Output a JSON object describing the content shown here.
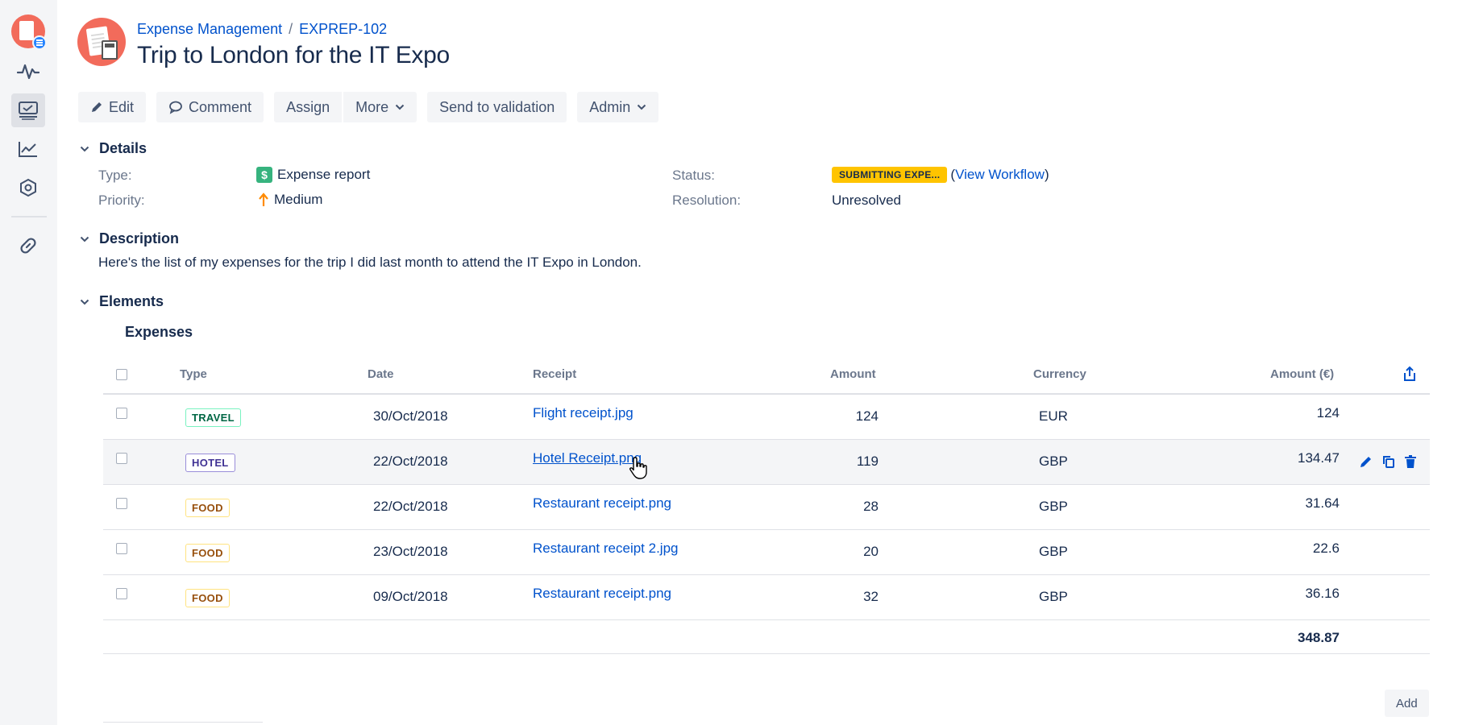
{
  "header": {
    "breadcrumb": {
      "project": "Expense Management",
      "separator": "/",
      "issue_key": "EXPREP-102"
    },
    "title": "Trip to London for the IT Expo"
  },
  "toolbar": {
    "edit_label": "Edit",
    "comment_label": "Comment",
    "assign_label": "Assign",
    "more_label": "More",
    "send_label": "Send to validation",
    "admin_label": "Admin"
  },
  "details": {
    "heading": "Details",
    "type_label": "Type:",
    "type_icon_glyph": "$",
    "type_value": "Expense report",
    "priority_label": "Priority:",
    "priority_value": "Medium",
    "status_label": "Status:",
    "status_value": "SUBMITTING EXPE...",
    "view_workflow_open": "(",
    "view_workflow_link": "View Workflow",
    "view_workflow_close": ")",
    "resolution_label": "Resolution:",
    "resolution_value": "Unresolved"
  },
  "description": {
    "heading": "Description",
    "text": "Here's the list of my expenses for the trip I did last month to attend the IT Expo in London."
  },
  "elements": {
    "heading": "Elements",
    "subheading": "Expenses",
    "columns": {
      "type": "Type",
      "date": "Date",
      "receipt": "Receipt",
      "amount": "Amount",
      "currency": "Currency",
      "amount_eur": "Amount (€)"
    },
    "rows": [
      {
        "type": "TRAVEL",
        "date": "30/Oct/2018",
        "receipt": "Flight receipt.jpg",
        "amount": "124",
        "currency": "EUR",
        "amount_eur": "124"
      },
      {
        "type": "HOTEL",
        "date": "22/Oct/2018",
        "receipt": "Hotel Receipt.png",
        "amount": "119",
        "currency": "GBP",
        "amount_eur": "134.47"
      },
      {
        "type": "FOOD",
        "date": "22/Oct/2018",
        "receipt": "Restaurant receipt.png",
        "amount": "28",
        "currency": "GBP",
        "amount_eur": "31.64"
      },
      {
        "type": "FOOD",
        "date": "23/Oct/2018",
        "receipt": "Restaurant receipt 2.jpg",
        "amount": "20",
        "currency": "GBP",
        "amount_eur": "22.6"
      },
      {
        "type": "FOOD",
        "date": "09/Oct/2018",
        "receipt": "Restaurant receipt.png",
        "amount": "32",
        "currency": "GBP",
        "amount_eur": "36.16"
      }
    ],
    "total": "348.87",
    "add_label": "Add"
  },
  "colors": {
    "link": "#0052cc",
    "status_yellow": "#ffc400",
    "priority_orange": "#ff8b00",
    "type_green": "#36b37e",
    "avatar_coral": "#f26b5b"
  },
  "icons": {
    "sidebar": [
      "project-avatar-icon",
      "activity-icon",
      "queues-icon",
      "reports-icon",
      "settings-icon",
      "link-icon"
    ],
    "toolbar": [
      "pencil-icon",
      "comment-icon",
      "chevron-down-icon"
    ],
    "row_actions": [
      "edit-icon",
      "copy-icon",
      "delete-icon"
    ],
    "table": [
      "export-icon"
    ]
  }
}
